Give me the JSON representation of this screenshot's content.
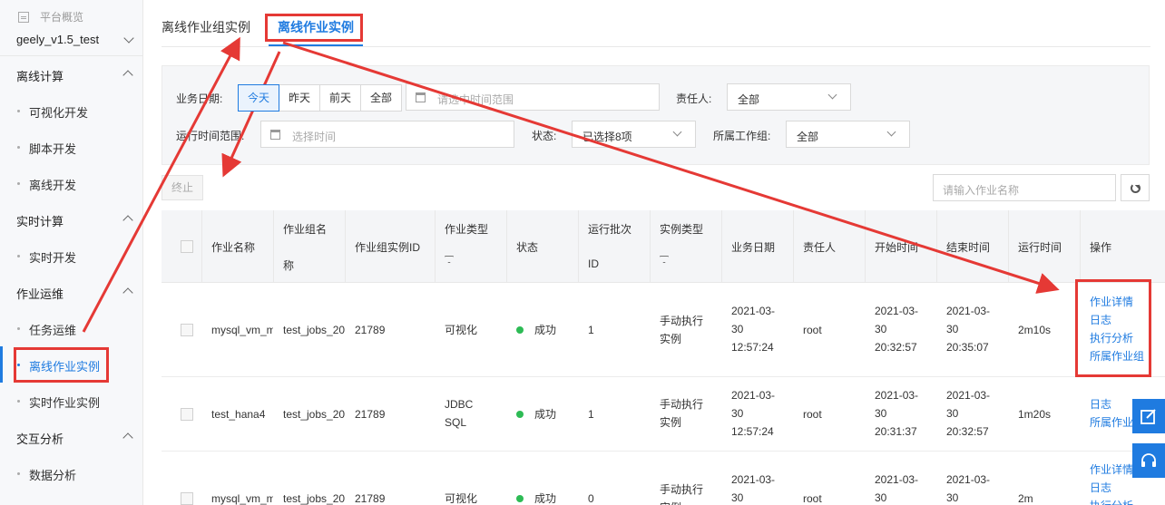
{
  "sidebar": {
    "overview": "平台概览",
    "project": "geely_v1.5_test",
    "groups": [
      {
        "title": "离线计算",
        "items": [
          "可视化开发",
          "脚本开发",
          "离线开发"
        ]
      },
      {
        "title": "实时计算",
        "items": [
          "实时开发"
        ]
      },
      {
        "title": "作业运维",
        "items": [
          "任务运维",
          "离线作业实例",
          "实时作业实例"
        ]
      },
      {
        "title": "交互分析",
        "items": [
          "数据分析"
        ]
      }
    ]
  },
  "tabs": [
    {
      "label": "离线作业组实例",
      "active": false
    },
    {
      "label": "离线作业实例",
      "active": true
    }
  ],
  "filters": {
    "biz_date_label": "业务日期:",
    "biz_date_options": [
      "今天",
      "昨天",
      "前天",
      "全部"
    ],
    "date_range_placeholder": "请选中时间范围",
    "owner_label": "责任人:",
    "owner_value": "全部",
    "run_time_label": "运行时间范围:",
    "run_time_placeholder": "选择时间",
    "status_label": "状态:",
    "status_value": "已选择8项",
    "group_label": "所属工作组:",
    "group_value": "全部"
  },
  "toolbar": {
    "stop_label": "终止",
    "search_placeholder": "请输入作业名称"
  },
  "table": {
    "headers": [
      "作业名称",
      "作业组名称",
      "作业组实例ID",
      "作业类型",
      "状态",
      "运行批次ID",
      "实例类型",
      "业务日期",
      "责任人",
      "开始时间",
      "结束时间",
      "运行时间",
      "操作"
    ],
    "header_lines": {
      "group_name": [
        "作业组名",
        "称"
      ],
      "batch_id": [
        "运行批次",
        "ID"
      ]
    },
    "rows": [
      {
        "name": "mysql_vm_m",
        "group": "test_jobs_20",
        "group_instance_id": "21789",
        "type": [
          "可视化"
        ],
        "status": "成功",
        "batch": "1",
        "instance_type": [
          "手动执行",
          "实例"
        ],
        "biz_date": [
          "2021-03-",
          "30",
          "12:57:24"
        ],
        "owner": "root",
        "start": [
          "2021-03-",
          "30",
          "20:32:57"
        ],
        "end": [
          "2021-03-",
          "30",
          "20:35:07"
        ],
        "duration": "2m10s",
        "ops": [
          "作业详情",
          "日志",
          "执行分析",
          "所属作业组"
        ]
      },
      {
        "name": "test_hana4",
        "group": "test_jobs_20",
        "group_instance_id": "21789",
        "type": [
          "JDBC",
          "SQL"
        ],
        "status": "成功",
        "batch": "1",
        "instance_type": [
          "手动执行",
          "实例"
        ],
        "biz_date": [
          "2021-03-",
          "30",
          "12:57:24"
        ],
        "owner": "root",
        "start": [
          "2021-03-",
          "30",
          "20:31:37"
        ],
        "end": [
          "2021-03-",
          "30",
          "20:32:57"
        ],
        "duration": "1m20s",
        "ops": [
          "日志",
          "所属作业"
        ]
      },
      {
        "name": "mysql_vm_m",
        "group": "test_jobs_20",
        "group_instance_id": "21789",
        "type": [
          "可视化"
        ],
        "status": "成功",
        "batch": "0",
        "instance_type": [
          "手动执行",
          "实例"
        ],
        "biz_date": [
          "2021-03-",
          "30"
        ],
        "owner": "root",
        "start": [
          "2021-03-",
          "30"
        ],
        "end": [
          "2021-03-",
          "30"
        ],
        "duration": "2m",
        "ops": [
          "作业详情",
          "日志",
          "执行分析"
        ]
      }
    ]
  },
  "colors": {
    "accent": "#1f7be0",
    "annotation": "#e53935",
    "success": "#2dbb55"
  }
}
